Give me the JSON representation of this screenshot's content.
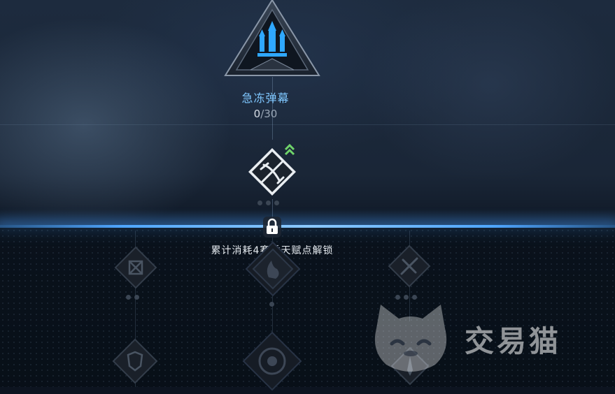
{
  "skill_tree": {
    "top_node": {
      "name": "急冻弹幕",
      "points_current": "0",
      "points_separator": "/",
      "points_max": "30",
      "icon": "ice-barrage-icon"
    },
    "mid_node": {
      "icon": "crossed-weapon-icon",
      "upgrade_indicator": "double-chevron-up-icon"
    },
    "lock": {
      "icon": "padlock-icon",
      "text": "累计消耗4赛季天赋点解锁"
    },
    "locked_nodes": [
      {
        "icon": "crosshair-icon"
      },
      {
        "icon": "flame-shield-icon"
      },
      {
        "icon": "tools-icon"
      },
      {
        "icon": "shield-icon"
      },
      {
        "icon": "gear-target-icon"
      },
      {
        "icon": "blade-icon"
      }
    ]
  },
  "watermark": {
    "text": "交易猫",
    "icon": "cat-logo-icon"
  },
  "colors": {
    "accent_blue": "#4fa6ff",
    "title_blue": "#7fc7ff",
    "upgrade_green": "#6fd36a"
  }
}
